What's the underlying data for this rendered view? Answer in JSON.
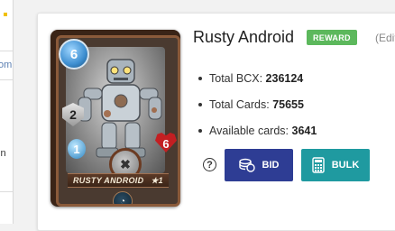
{
  "left_fragments": {
    "line1": "om",
    "line2": "in"
  },
  "card": {
    "name": "RUSTY ANDROID",
    "level_star": "★1",
    "mana": "6",
    "armor": "2",
    "speed": "1",
    "health": "6"
  },
  "header": {
    "title": "Rusty Android",
    "badge": "REWARD",
    "edit_link": "(Edit"
  },
  "stats": [
    {
      "label": "Total BCX:",
      "value": "236124"
    },
    {
      "label": "Total Cards:",
      "value": "75655"
    },
    {
      "label": "Available cards:",
      "value": "3641"
    }
  ],
  "actions": {
    "help": "?",
    "bid_label": "BID",
    "bulk_label": "BULK"
  },
  "colors": {
    "bid": "#2e3d94",
    "bulk": "#1f9aa0",
    "reward": "#5cb85c"
  }
}
